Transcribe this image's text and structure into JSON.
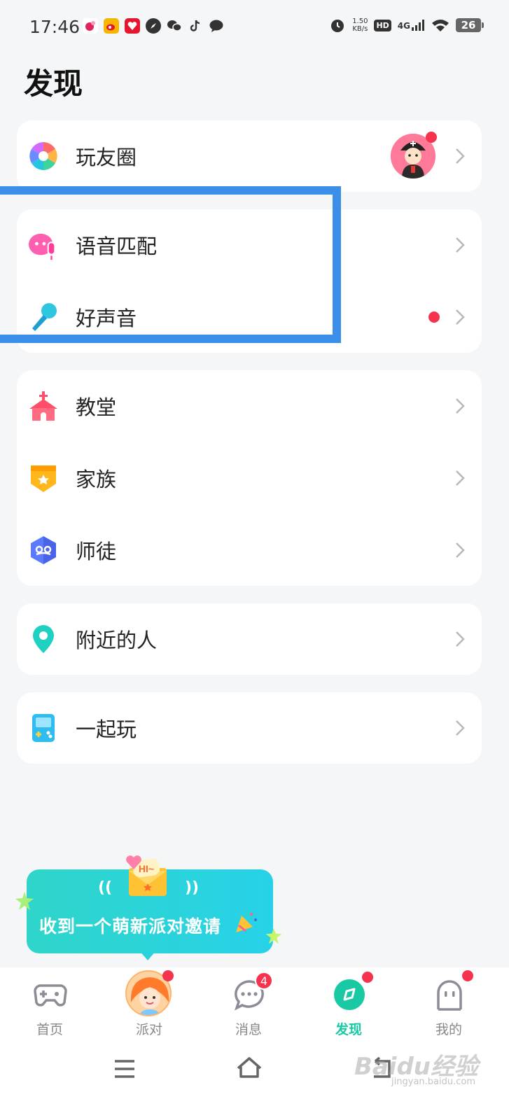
{
  "status_bar": {
    "time": "17:46",
    "speed_value": "1.50",
    "speed_unit": "KB/s",
    "hd": "HD",
    "network": "4G",
    "battery": "26"
  },
  "page": {
    "title": "发现"
  },
  "sections": {
    "moments": {
      "label": "玩友圈"
    },
    "voice_match": {
      "label": "语音匹配"
    },
    "good_voice": {
      "label": "好声音"
    },
    "church": {
      "label": "教堂"
    },
    "family": {
      "label": "家族"
    },
    "mentor": {
      "label": "师徒"
    },
    "nearby": {
      "label": "附近的人"
    },
    "play_together": {
      "label": "一起玩"
    }
  },
  "promo": {
    "text": "收到一个萌新派对邀请",
    "envelope_text": "HI~"
  },
  "tabbar": {
    "home": "首页",
    "party": "派对",
    "messages": "消息",
    "messages_badge": "4",
    "discover": "发现",
    "me": "我的"
  },
  "watermark": {
    "main": "Baidu经验",
    "sub": "jingyan.baidu.com"
  },
  "colors": {
    "accent": "#19c9a3",
    "red_dot": "#f5334e",
    "highlight": "#3b8fe8",
    "promo": "#2fd5c9"
  },
  "icons": {
    "moments": "camera-shutter-icon",
    "voice_match": "voice-bubble-mic-icon",
    "good_voice": "microphone-icon",
    "church": "church-icon",
    "family": "family-shield-icon",
    "mentor": "mentor-hexagon-icon",
    "nearby": "location-pin-icon",
    "play_together": "game-console-icon"
  }
}
